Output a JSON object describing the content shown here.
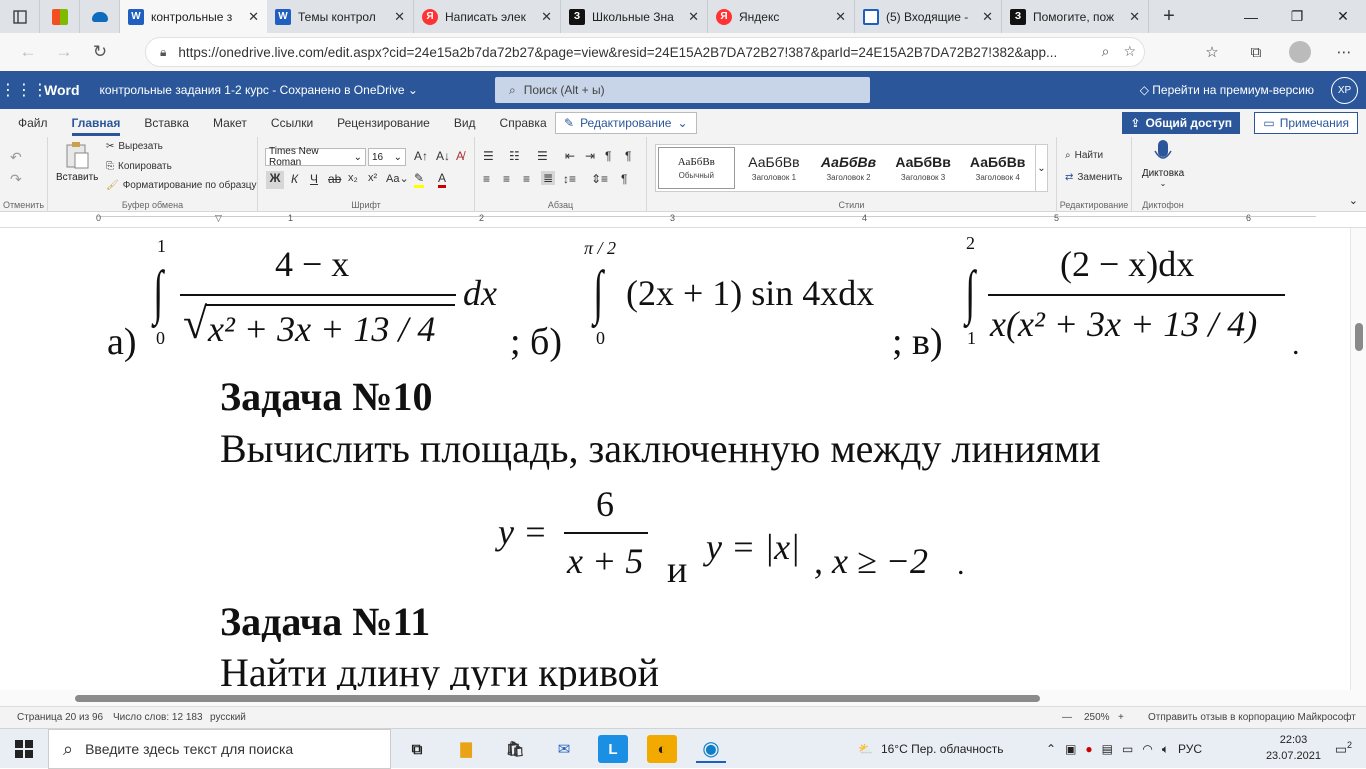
{
  "browser": {
    "tabs": [
      {
        "title": "контрольные з",
        "icon": "word-icon",
        "active": true
      },
      {
        "title": "Темы контрол",
        "icon": "word-icon"
      },
      {
        "title": "Написать элек",
        "icon": "yandex-icon"
      },
      {
        "title": "Школьные Зна",
        "icon": "znanija-icon"
      },
      {
        "title": "Яндекс",
        "icon": "yandex-icon"
      },
      {
        "title": "(5) Входящие -",
        "icon": "mail-icon"
      },
      {
        "title": "Помогите, пож",
        "icon": "znanija-icon"
      }
    ],
    "url": "https://onedrive.live.com/edit.aspx?cid=24e15a2b7da72b27&page=view&resid=24E15A2B7DA72B27!387&parId=24E15A2B7DA72B27!382&app..."
  },
  "word": {
    "app_name": "Word",
    "doc_title": "контрольные задания 1-2 курс",
    "save_status": "Сохранено в OneDrive",
    "search_placeholder": "Поиск (Alt + ы)",
    "premium": "Перейти на премиум-версию",
    "avatar": "ХР",
    "ribbon_tabs": [
      "Файл",
      "Главная",
      "Вставка",
      "Макет",
      "Ссылки",
      "Рецензирование",
      "Вид",
      "Справка"
    ],
    "edit_mode": "Редактирование",
    "share": "Общий доступ",
    "comments": "Примечания",
    "clipboard": {
      "paste": "Вставить",
      "cut": "Вырезать",
      "copy": "Копировать",
      "format_painter": "Форматирование по образцу",
      "label": "Буфер обмена"
    },
    "undo_label": "Отменить",
    "font": {
      "name": "Times New Roman",
      "size": "16",
      "label": "Шрифт",
      "bold": "Ж",
      "italic": "К",
      "underline": "Ч"
    },
    "paragraph_label": "Абзац",
    "styles": [
      {
        "preview": "АаБбВв",
        "name": "Обычный"
      },
      {
        "preview": "АаБбВв",
        "name": "Заголовок 1"
      },
      {
        "preview": "АаБбВв",
        "name": "Заголовок 2"
      },
      {
        "preview": "АаБбВв",
        "name": "Заголовок 3"
      },
      {
        "preview": "АаБбВв",
        "name": "Заголовок 4"
      }
    ],
    "styles_label": "Стили",
    "editing": {
      "find": "Найти",
      "replace": "Заменить",
      "label": "Редактирование"
    },
    "dictation": {
      "button": "Диктовка",
      "label": "Диктофон"
    },
    "ruler_numbers": [
      "1",
      "2",
      "3",
      "4",
      "5",
      "6"
    ]
  },
  "document": {
    "items_line": {
      "a_label": "а)",
      "a_upper": "1",
      "a_lower": "0",
      "a_num": "4 − x",
      "a_den": "x² + 3x + 13 / 4",
      "a_dx": "dx",
      "b_label": "; б)",
      "b_upper": "π / 2",
      "b_lower": "0",
      "b_expr": "(2x + 1) sin 4xdx",
      "c_label": "; в)",
      "c_upper": "2",
      "c_lower": "1",
      "c_num": "(2 − x)dx",
      "c_den": "x(x² + 3x + 13 / 4)",
      "end": "."
    },
    "task10_title": "Задача №10",
    "task10_text": "Вычислить площадь, заключенную между линиями",
    "task10_formula": {
      "y1_lhs": "y =",
      "y1_num": "6",
      "y1_den": "x + 5",
      "and": "и",
      "y2": "y = |x|",
      "cond": ", x ≥ −2",
      "end": "."
    },
    "task11_title": "Задача №11",
    "task11_text": "Найти длину дуги кривой"
  },
  "status": {
    "page": "Страница 20 из 96",
    "words": "Число слов: 12 183",
    "language": "русский",
    "zoom": "250%",
    "feedback": "Отправить отзыв в корпорацию Майкрософт"
  },
  "taskbar": {
    "search_placeholder": "Введите здесь текст для поиска",
    "weather": "16°C  Пер. облачность",
    "lang": "РУС",
    "time": "22:03",
    "date": "23.07.2021",
    "notifications": "2"
  }
}
